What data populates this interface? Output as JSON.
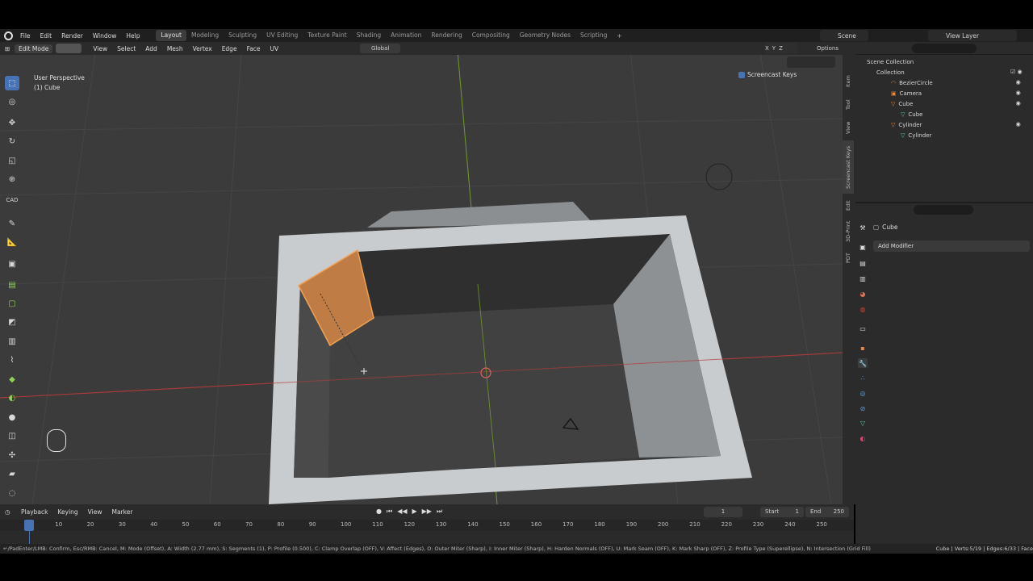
{
  "menubar": {
    "menus": [
      "File",
      "Edit",
      "Render",
      "Window",
      "Help"
    ],
    "workspaces": [
      "Layout",
      "Modeling",
      "Sculpting",
      "UV Editing",
      "Texture Paint",
      "Shading",
      "Animation",
      "Rendering",
      "Compositing",
      "Geometry Nodes",
      "Scripting"
    ],
    "active_workspace": "Layout",
    "scene": "Scene",
    "view_layer": "View Layer"
  },
  "viewport_header": {
    "mode": "Edit Mode",
    "menus": [
      "View",
      "Select",
      "Add",
      "Mesh",
      "Vertex",
      "Edge",
      "Face",
      "UV"
    ],
    "transform_orientation": "Global",
    "options_label": "Options",
    "axes": [
      "X",
      "Y",
      "Z"
    ]
  },
  "viewport": {
    "view_name": "User Perspective",
    "object_name": "(1) Cube",
    "screencast_label": "Screencast Keys",
    "cad_label": "CAD"
  },
  "side_tabs": [
    "Item",
    "Tool",
    "View",
    "Screencast Keys",
    "Edit",
    "3D-Print",
    "PDT"
  ],
  "outliner": {
    "root": "Scene Collection",
    "collection": "Collection",
    "items": [
      {
        "name": "BezierCircle",
        "depth": 2
      },
      {
        "name": "Camera",
        "depth": 2
      },
      {
        "name": "Cube",
        "depth": 2
      },
      {
        "name": "Cube",
        "depth": 3
      },
      {
        "name": "Cylinder",
        "depth": 2
      },
      {
        "name": "Cylinder",
        "depth": 3
      }
    ]
  },
  "properties": {
    "object_name": "Cube",
    "add_modifier": "Add Modifier"
  },
  "timeline": {
    "menus": [
      "Playback",
      "Keying",
      "View",
      "Marker"
    ],
    "current_frame": "1",
    "start_label": "Start",
    "start_value": "1",
    "end_label": "End",
    "end_value": "250",
    "ticks": [
      "1",
      "10",
      "20",
      "30",
      "40",
      "50",
      "60",
      "70",
      "80",
      "90",
      "100",
      "110",
      "120",
      "130",
      "140",
      "150",
      "160",
      "170",
      "180",
      "190",
      "200",
      "210",
      "220",
      "230",
      "240",
      "250"
    ]
  },
  "statusbar": {
    "left": "↵/PadEnter/LMB: Confirm, Esc/RMB: Cancel, M: Mode (Offset), A: Width (2.77 mm), S: Segments (1), P: Profile (0.500), C: Clamp Overlap (OFF), V: Affect (Edges), O: Outer Miter (Sharp), I: Inner Miter (Sharp), H: Harden Normals (OFF), U: Mark Seam (OFF), K: Mark Sharp (OFF), Z: Profile Type (Superellipse), N: Intersection (Grid Fill)",
    "right": "Cube | Verts:5/19 | Edges:6/33 | Face"
  },
  "colors": {
    "accent": "#4772b3",
    "selection": "#e8873a",
    "mesh_light": "#c9cccf",
    "viewport_bg": "#3b3b3b"
  }
}
